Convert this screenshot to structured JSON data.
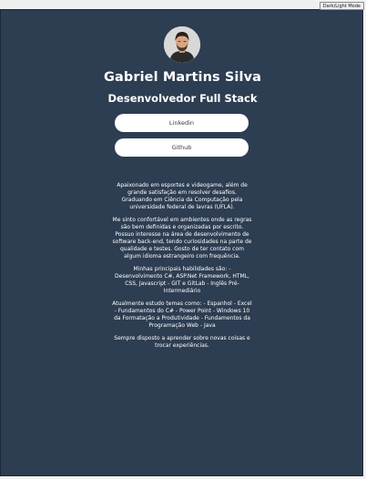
{
  "toggle": {
    "label": "Dark/Light Mode"
  },
  "profile": {
    "name": "Gabriel Martins Silva",
    "role": "Desenvolvedor Full Stack"
  },
  "links": [
    {
      "label": "Linkedin"
    },
    {
      "label": "Github"
    }
  ],
  "bio": {
    "p1": "Apaixonado em esportes e videogame, além de grande satisfação em resolver desafios. Graduando em Ciência da Computação pela universidade federal de lavras (UFLA).",
    "p2": "Me sinto confortável em ambientes onde as regras são bem definidas e organizadas por escrito. Possuo interesse na área de desenvolvimento de software back-end, tendo curiosidades na parte de qualidade e testes. Gosto de ter contato com algum idioma estrangeiro com frequência.",
    "p3": "Minhas principais habilidades são: - Desenvolvimento C#, ASP.Net Framework, HTML, CSS, Javascript - GIT e GitLab - Inglês Pré-Intermediário",
    "p4": "Atualmente estudo temas como: - Espanhol - Excel - Fundamentos do C# - Power Point - Windows 10 da Formatação a Produtividade - Fundamentos da Programação Web - Java",
    "p5": "Sempre disposto a aprender sobre novas coisas e trocar experiências."
  },
  "colors": {
    "background": "#2d3d52",
    "text": "#ffffff",
    "button": "#ffffff"
  }
}
